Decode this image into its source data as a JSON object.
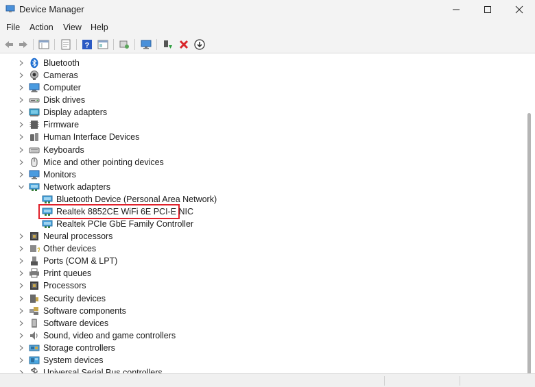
{
  "window": {
    "title": "Device Manager"
  },
  "menu": [
    "File",
    "Action",
    "View",
    "Help"
  ],
  "toolbar_icons": [
    "back-arrow-icon",
    "forward-arrow-icon",
    "properties-icon",
    "show-hidden-icon",
    "help-icon",
    "view-icon",
    "scan-hardware-icon",
    "monitor-icon",
    "update-driver-icon",
    "uninstall-icon",
    "download-icon"
  ],
  "tree": {
    "categories": [
      {
        "label": "Bluetooth",
        "icon": "bluetooth-icon"
      },
      {
        "label": "Cameras",
        "icon": "camera-icon"
      },
      {
        "label": "Computer",
        "icon": "computer-icon"
      },
      {
        "label": "Disk drives",
        "icon": "disk-drive-icon"
      },
      {
        "label": "Display adapters",
        "icon": "display-adapter-icon"
      },
      {
        "label": "Firmware",
        "icon": "firmware-icon"
      },
      {
        "label": "Human Interface Devices",
        "icon": "hid-icon"
      },
      {
        "label": "Keyboards",
        "icon": "keyboard-icon"
      },
      {
        "label": "Mice and other pointing devices",
        "icon": "mouse-icon"
      },
      {
        "label": "Monitors",
        "icon": "monitor-icon"
      },
      {
        "label": "Network adapters",
        "icon": "network-adapter-icon",
        "expanded": true,
        "children": [
          {
            "label": "Bluetooth Device (Personal Area Network)",
            "icon": "network-adapter-icon"
          },
          {
            "label": "Realtek 8852CE WiFi 6E PCI-E NIC",
            "icon": "network-adapter-icon",
            "highlighted": true
          },
          {
            "label": "Realtek PCIe GbE Family Controller",
            "icon": "network-adapter-icon"
          }
        ]
      },
      {
        "label": "Neural processors",
        "icon": "processor-icon"
      },
      {
        "label": "Other devices",
        "icon": "other-devices-icon"
      },
      {
        "label": "Ports (COM & LPT)",
        "icon": "port-icon"
      },
      {
        "label": "Print queues",
        "icon": "printer-icon"
      },
      {
        "label": "Processors",
        "icon": "processor-icon"
      },
      {
        "label": "Security devices",
        "icon": "security-device-icon"
      },
      {
        "label": "Software components",
        "icon": "software-component-icon"
      },
      {
        "label": "Software devices",
        "icon": "software-device-icon"
      },
      {
        "label": "Sound, video and game controllers",
        "icon": "sound-icon"
      },
      {
        "label": "Storage controllers",
        "icon": "storage-controller-icon"
      },
      {
        "label": "System devices",
        "icon": "system-devices-icon"
      },
      {
        "label": "Universal Serial Bus controllers",
        "icon": "usb-icon"
      }
    ]
  },
  "colors": {
    "highlight_border": "#e0202a",
    "chrome": "#f3f3f3"
  }
}
